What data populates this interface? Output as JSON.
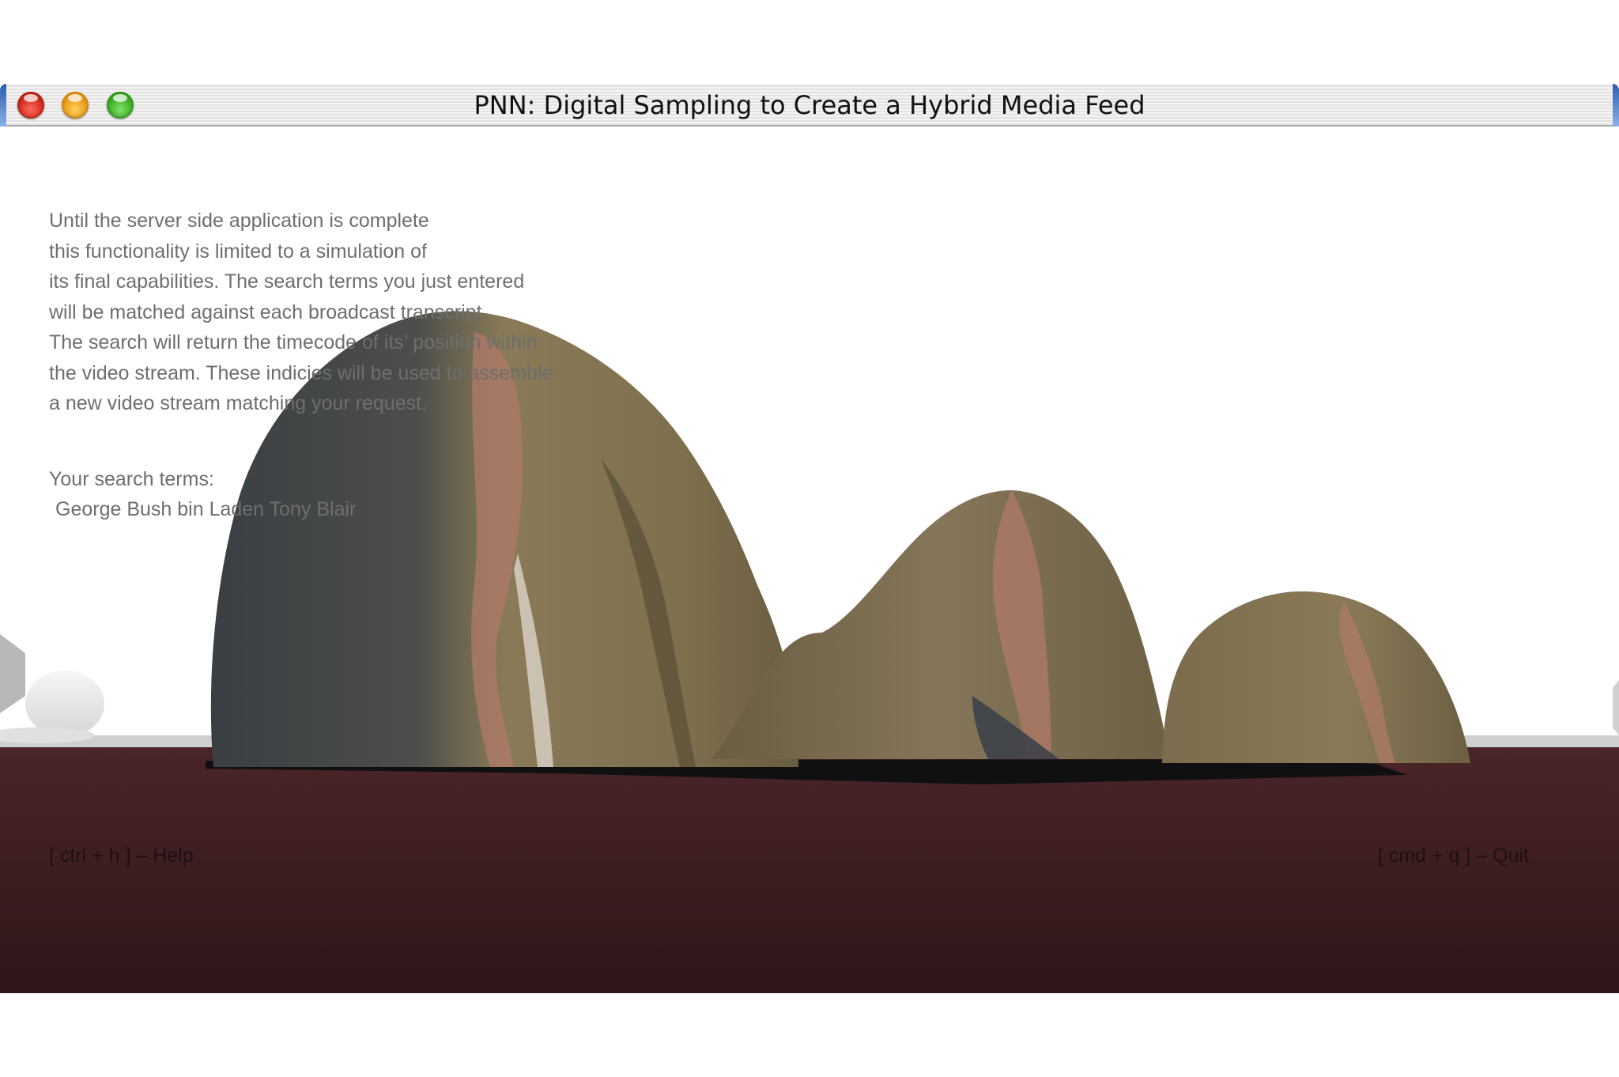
{
  "window": {
    "title": "PNN: Digital Sampling to Create a Hybrid Media Feed"
  },
  "info": {
    "lines": [
      "Until the server side application is complete",
      "this functionality is limited to a simulation of",
      "its final capabilities. The search terms you just entered",
      "will be matched against each broadcast transcript.",
      "The search will return the timecode of its’ position within",
      "the video stream. These indicies will be used to assemble",
      "a new video stream matching your request."
    ]
  },
  "search": {
    "label": "Your search terms:",
    "terms": "George Bush bin Laden Tony Blair"
  },
  "shortcuts": {
    "help": "[ ctrl + h ] – Help",
    "quit": "[ cmd + q ] – Quit"
  },
  "colors": {
    "floor": "#3a1c1f",
    "blob_skin": "#7d6f4e",
    "text_gray": "#6e6e6e"
  }
}
